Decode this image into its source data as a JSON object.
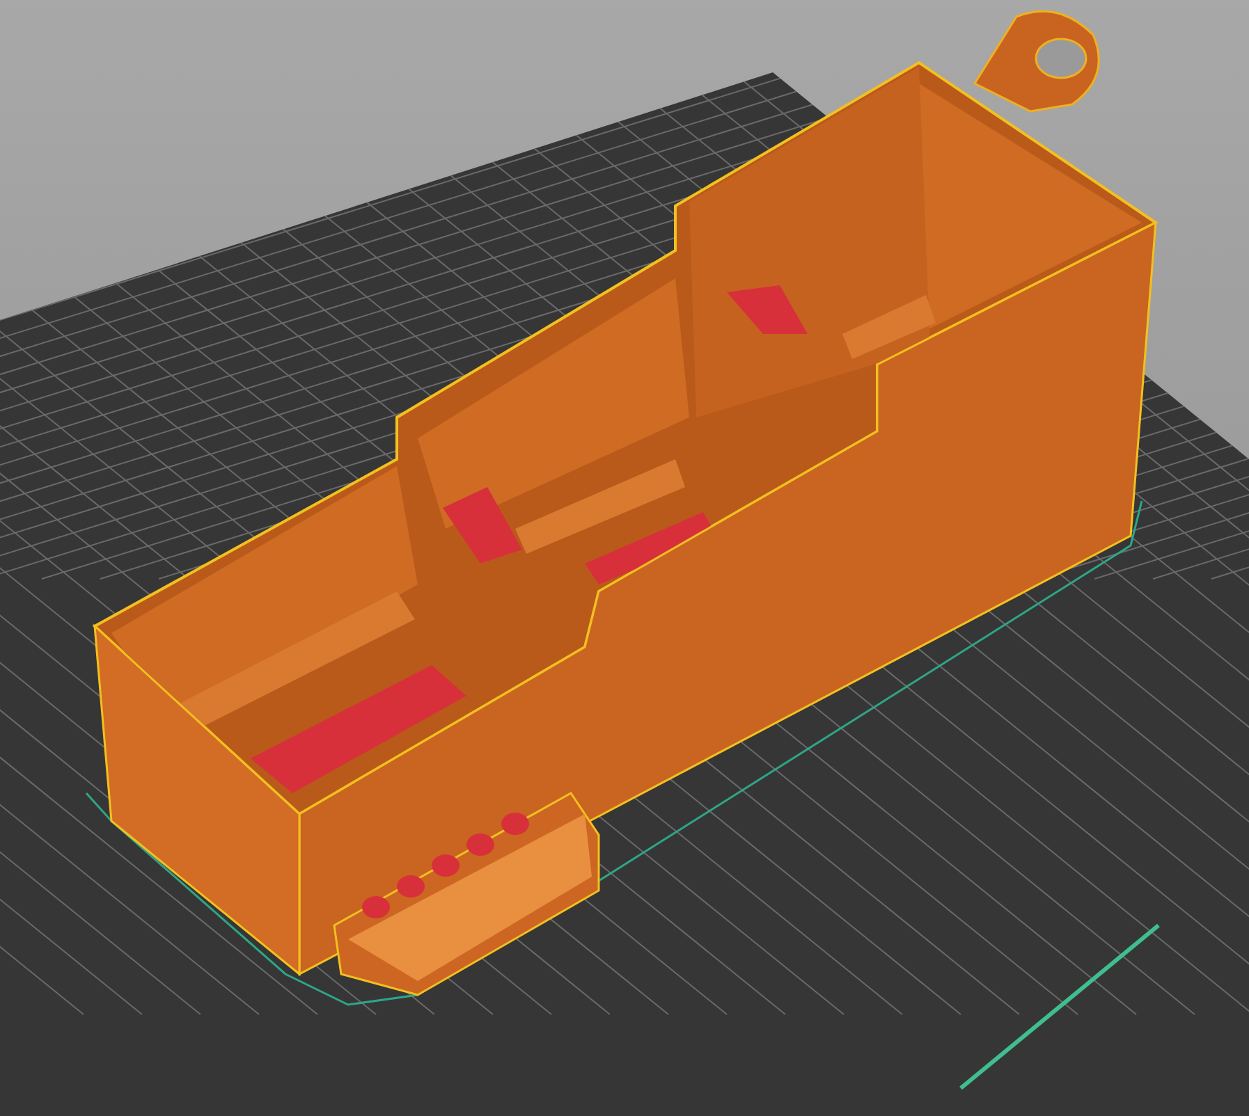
{
  "viewport": {
    "kind": "preview"
  }
}
